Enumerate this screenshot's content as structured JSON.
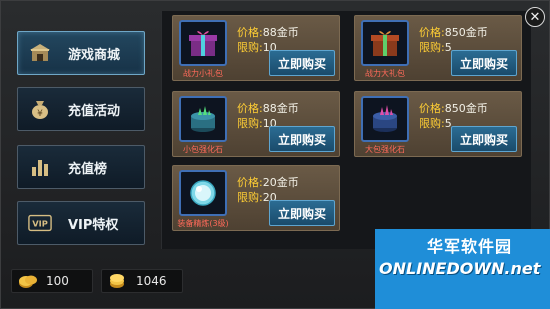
{
  "menu": {
    "items": [
      {
        "label": "游戏商城",
        "icon": "shop-icon",
        "active": true
      },
      {
        "label": "充值活动",
        "icon": "money-bag-icon",
        "active": false
      },
      {
        "label": "充值榜",
        "icon": "ranking-bars-icon",
        "active": false
      },
      {
        "label": "VIP特权",
        "icon": "vip-icon",
        "active": false
      }
    ]
  },
  "store": {
    "items": [
      {
        "name": "战力小礼包",
        "price_label": "价格:",
        "price": "88金币",
        "limit_label": "限购:",
        "limit": "10",
        "buy": "立即购买",
        "icon": "gift-box-pink-icon"
      },
      {
        "name": "战力大礼包",
        "price_label": "价格:",
        "price": "850金币",
        "limit_label": "限购:",
        "limit": "5",
        "buy": "立即购买",
        "icon": "gift-box-orange-icon"
      },
      {
        "name": "小包强化石",
        "price_label": "价格:",
        "price": "88金币",
        "limit_label": "限购:",
        "limit": "10",
        "buy": "立即购买",
        "icon": "green-crystal-box-icon"
      },
      {
        "name": "大包强化石",
        "price_label": "价格:",
        "price": "850金币",
        "limit_label": "限购:",
        "limit": "5",
        "buy": "立即购买",
        "icon": "pink-crystal-box-icon"
      },
      {
        "name": "装备精炼(3级)",
        "price_label": "价格:",
        "price": "20金币",
        "limit_label": "限购:",
        "limit": "20",
        "buy": "立即购买",
        "icon": "refine-orb-icon"
      }
    ]
  },
  "currency": {
    "gold": "100",
    "coins": "1046"
  },
  "watermark": {
    "cn": "华军软件园",
    "en": "ONLINEDOWN.net"
  },
  "colors": {
    "price_label": "#ffce34",
    "item_name": "#ff6a5a",
    "button_blue": "#2b6c93"
  }
}
